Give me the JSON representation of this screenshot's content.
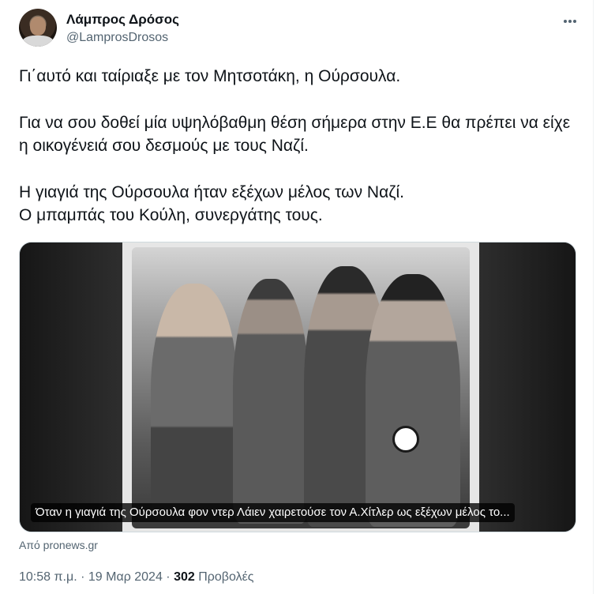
{
  "tweet": {
    "author_name": "Λάμπρος Δρόσος",
    "author_handle": "@LamprosDrosos",
    "more_icon": "more-horizontal-icon",
    "lines": [
      "Γι΄αυτό και ταίριαξε με τον Μητσοτάκη, η Ούρσουλα.",
      "Για να σου δοθεί μία υψηλόβαθμη θέση σήμερα στην Ε.Ε θα πρέπει να είχε",
      "η οικογένειά σου δεσμούς με τους Ναζί.",
      "Η γιαγιά της Ούρσουλα ήταν εξέχων μέλος των Ναζί.",
      "Ο μπαμπάς του Κούλη, συνεργάτης τους."
    ],
    "media": {
      "caption": "Όταν η γιαγιά της Ούρσουλα φον ντερ Λάιεν χαιρετούσε τον Α.Χίτλερ ως εξέχων μέλος το..."
    },
    "source": "Από pronews.gr",
    "meta": {
      "time": "10:58 π.μ.",
      "date": "19 Μαρ 2024",
      "separator": "·",
      "views_count": "302",
      "views_label": "Προβολές"
    }
  }
}
